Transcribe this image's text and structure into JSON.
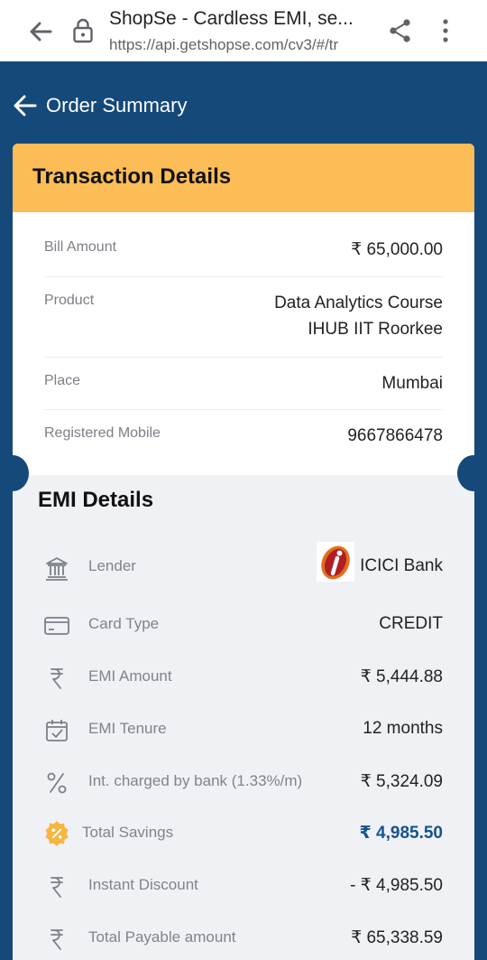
{
  "browser": {
    "title": "ShopSe - Cardless EMI, se...",
    "url": "https://api.getshopse.com/cv3/#/tr"
  },
  "header": {
    "title": "Order Summary"
  },
  "transaction": {
    "heading": "Transaction Details",
    "rows": [
      {
        "label": "Bill Amount",
        "value": "₹ 65,000.00"
      },
      {
        "label": "Product",
        "value_line1": "Data Analytics Course",
        "value_line2": "IHUB IIT Roorkee"
      },
      {
        "label": "Place",
        "value": "Mumbai"
      },
      {
        "label": "Registered Mobile",
        "value": "9667866478"
      }
    ]
  },
  "emi": {
    "heading": "EMI Details",
    "rows": [
      {
        "icon": "bank-icon",
        "label": "Lender",
        "value": "ICICI Bank"
      },
      {
        "icon": "card-icon",
        "label": "Card Type",
        "value": "CREDIT"
      },
      {
        "icon": "rupee-icon",
        "label": "EMI Amount",
        "value": "₹ 5,444.88"
      },
      {
        "icon": "calendar-icon",
        "label": "EMI Tenure",
        "value": "12 months"
      },
      {
        "icon": "percent-icon",
        "label": "Int. charged by bank (1.33%/m)",
        "value": "₹ 5,324.09"
      },
      {
        "icon": "discount-badge-icon",
        "label": "Total Savings",
        "value": "₹ 4,985.50"
      },
      {
        "icon": "rupee-icon",
        "label": "Instant Discount",
        "value": "- ₹ 4,985.50"
      },
      {
        "icon": "rupee-icon",
        "label": "Total Payable amount",
        "value": "₹ 65,338.59"
      }
    ]
  },
  "colors": {
    "brand_blue": "#14497a",
    "header_yellow": "#fdbd56",
    "savings_blue": "#15538f",
    "savings_badge": "#f8b53f"
  }
}
